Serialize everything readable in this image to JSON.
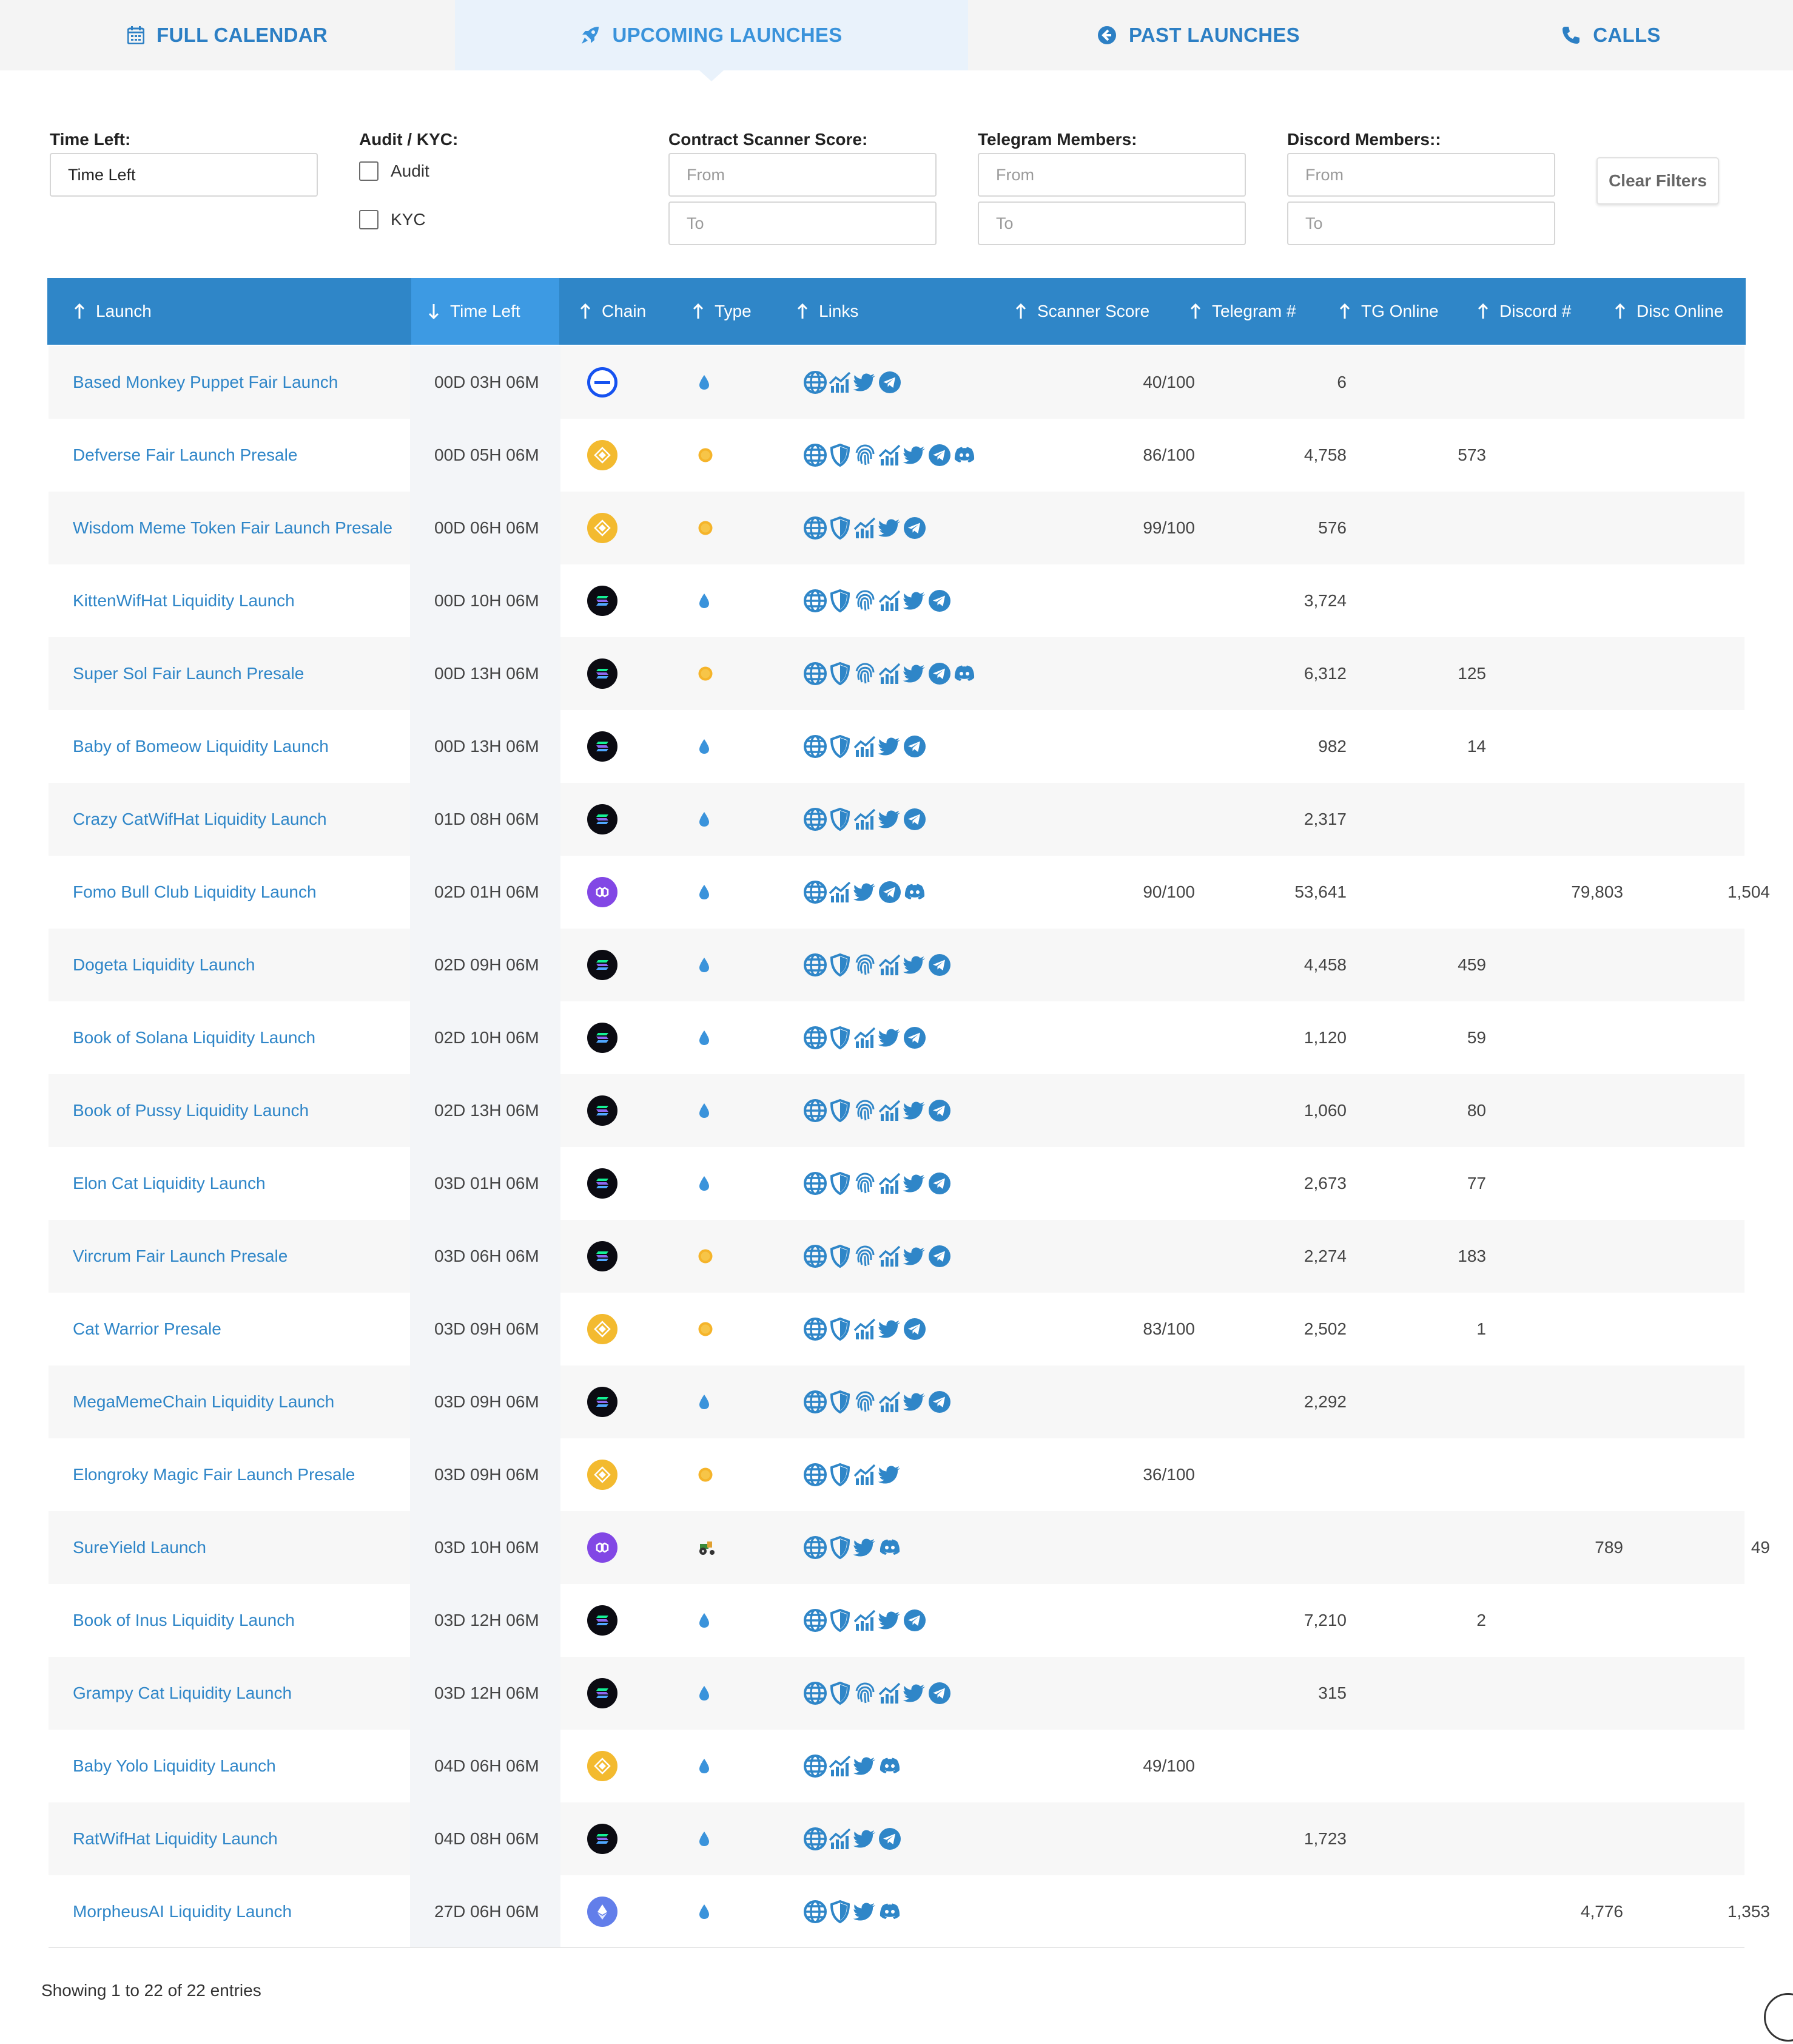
{
  "tabs": [
    {
      "label": "FULL CALENDAR",
      "icon": "calendar-icon"
    },
    {
      "label": "UPCOMING LAUNCHES",
      "icon": "rocket-icon",
      "active": true
    },
    {
      "label": "PAST LAUNCHES",
      "icon": "arrow-left-circle-icon"
    },
    {
      "label": "CALLS",
      "icon": "phone-icon"
    }
  ],
  "filters": {
    "time_left": {
      "label": "Time Left:",
      "value": "Time Left"
    },
    "audit_kyc": {
      "label": "Audit / KYC:",
      "options": [
        "Audit",
        "KYC"
      ]
    },
    "scanner": {
      "label": "Contract Scanner Score:",
      "from_placeholder": "From",
      "to_placeholder": "To"
    },
    "telegram": {
      "label": "Telegram Members:",
      "from_placeholder": "From",
      "to_placeholder": "To"
    },
    "discord": {
      "label": "Discord Members::",
      "from_placeholder": "From",
      "to_placeholder": "To"
    },
    "clear_label": "Clear Filters"
  },
  "table": {
    "columns": [
      "Launch",
      "Time Left",
      "Chain",
      "Type",
      "Links",
      "Scanner Score",
      "Telegram #",
      "TG Online",
      "Discord #",
      "Disc Online"
    ],
    "sorted_column": "Time Left",
    "rows": [
      {
        "launch": "Based Monkey Puppet Fair Launch",
        "time": "00D 03H 06M",
        "chain": "base",
        "type": "liquidity",
        "links": [
          "web",
          "chart",
          "twitter",
          "telegram"
        ],
        "score": "40/100",
        "tg": "6",
        "tg_online": "",
        "discord": "",
        "disc_online": ""
      },
      {
        "launch": "Defverse Fair Launch Presale",
        "time": "00D 05H 06M",
        "chain": "bnb",
        "type": "presale",
        "links": [
          "web",
          "shield",
          "fingerprint",
          "chart",
          "twitter",
          "telegram",
          "discord"
        ],
        "score": "86/100",
        "tg": "4,758",
        "tg_online": "573",
        "discord": "",
        "disc_online": ""
      },
      {
        "launch": "Wisdom Meme Token Fair Launch Presale",
        "time": "00D 06H 06M",
        "chain": "bnb",
        "type": "presale",
        "links": [
          "web",
          "shield",
          "chart",
          "twitter",
          "telegram"
        ],
        "score": "99/100",
        "tg": "576",
        "tg_online": "",
        "discord": "",
        "disc_online": ""
      },
      {
        "launch": "KittenWifHat Liquidity Launch",
        "time": "00D 10H 06M",
        "chain": "solana",
        "type": "liquidity",
        "links": [
          "web",
          "shield",
          "fingerprint",
          "chart",
          "twitter",
          "telegram"
        ],
        "score": "",
        "tg": "3,724",
        "tg_online": "",
        "discord": "",
        "disc_online": ""
      },
      {
        "launch": "Super Sol Fair Launch Presale",
        "time": "00D 13H 06M",
        "chain": "solana",
        "type": "presale",
        "links": [
          "web",
          "shield",
          "fingerprint",
          "chart",
          "twitter",
          "telegram",
          "discord"
        ],
        "score": "",
        "tg": "6,312",
        "tg_online": "125",
        "discord": "",
        "disc_online": ""
      },
      {
        "launch": "Baby of Bomeow Liquidity Launch",
        "time": "00D 13H 06M",
        "chain": "solana",
        "type": "liquidity",
        "links": [
          "web",
          "shield",
          "chart",
          "twitter",
          "telegram"
        ],
        "score": "",
        "tg": "982",
        "tg_online": "14",
        "discord": "",
        "disc_online": ""
      },
      {
        "launch": "Crazy CatWifHat Liquidity Launch",
        "time": "01D 08H 06M",
        "chain": "solana",
        "type": "liquidity",
        "links": [
          "web",
          "shield",
          "chart",
          "twitter",
          "telegram"
        ],
        "score": "",
        "tg": "2,317",
        "tg_online": "",
        "discord": "",
        "disc_online": ""
      },
      {
        "launch": "Fomo Bull Club Liquidity Launch",
        "time": "02D 01H 06M",
        "chain": "polygon",
        "type": "liquidity",
        "links": [
          "web",
          "chart",
          "twitter",
          "telegram",
          "discord"
        ],
        "score": "90/100",
        "tg": "53,641",
        "tg_online": "",
        "discord": "79,803",
        "disc_online": "1,504"
      },
      {
        "launch": "Dogeta Liquidity Launch",
        "time": "02D 09H 06M",
        "chain": "solana",
        "type": "liquidity",
        "links": [
          "web",
          "shield",
          "fingerprint",
          "chart",
          "twitter",
          "telegram"
        ],
        "score": "",
        "tg": "4,458",
        "tg_online": "459",
        "discord": "",
        "disc_online": ""
      },
      {
        "launch": "Book of Solana Liquidity Launch",
        "time": "02D 10H 06M",
        "chain": "solana",
        "type": "liquidity",
        "links": [
          "web",
          "shield",
          "chart",
          "twitter",
          "telegram"
        ],
        "score": "",
        "tg": "1,120",
        "tg_online": "59",
        "discord": "",
        "disc_online": ""
      },
      {
        "launch": "Book of Pussy Liquidity Launch",
        "time": "02D 13H 06M",
        "chain": "solana",
        "type": "liquidity",
        "links": [
          "web",
          "shield",
          "fingerprint",
          "chart",
          "twitter",
          "telegram"
        ],
        "score": "",
        "tg": "1,060",
        "tg_online": "80",
        "discord": "",
        "disc_online": ""
      },
      {
        "launch": "Elon Cat Liquidity Launch",
        "time": "03D 01H 06M",
        "chain": "solana",
        "type": "liquidity",
        "links": [
          "web",
          "shield",
          "fingerprint",
          "chart",
          "twitter",
          "telegram"
        ],
        "score": "",
        "tg": "2,673",
        "tg_online": "77",
        "discord": "",
        "disc_online": ""
      },
      {
        "launch": "Vircrum Fair Launch Presale",
        "time": "03D 06H 06M",
        "chain": "solana",
        "type": "presale",
        "links": [
          "web",
          "shield",
          "fingerprint",
          "chart",
          "twitter",
          "telegram"
        ],
        "score": "",
        "tg": "2,274",
        "tg_online": "183",
        "discord": "",
        "disc_online": ""
      },
      {
        "launch": "Cat Warrior Presale",
        "time": "03D 09H 06M",
        "chain": "bnb",
        "type": "presale",
        "links": [
          "web",
          "shield",
          "chart",
          "twitter",
          "telegram"
        ],
        "score": "83/100",
        "tg": "2,502",
        "tg_online": "1",
        "discord": "",
        "disc_online": ""
      },
      {
        "launch": "MegaMemeChain Liquidity Launch",
        "time": "03D 09H 06M",
        "chain": "solana",
        "type": "liquidity",
        "links": [
          "web",
          "shield",
          "fingerprint",
          "chart",
          "twitter",
          "telegram"
        ],
        "score": "",
        "tg": "2,292",
        "tg_online": "",
        "discord": "",
        "disc_online": ""
      },
      {
        "launch": "Elongroky Magic Fair Launch Presale",
        "time": "03D 09H 06M",
        "chain": "bnb",
        "type": "presale",
        "links": [
          "web",
          "shield",
          "chart",
          "twitter"
        ],
        "score": "36/100",
        "tg": "",
        "tg_online": "",
        "discord": "",
        "disc_online": ""
      },
      {
        "launch": "SureYield Launch",
        "time": "03D 10H 06M",
        "chain": "polygon",
        "type": "farm",
        "links": [
          "web",
          "shield",
          "twitter",
          "discord"
        ],
        "score": "",
        "tg": "",
        "tg_online": "",
        "discord": "789",
        "disc_online": "49"
      },
      {
        "launch": "Book of Inus Liquidity Launch",
        "time": "03D 12H 06M",
        "chain": "solana",
        "type": "liquidity",
        "links": [
          "web",
          "shield",
          "chart",
          "twitter",
          "telegram"
        ],
        "score": "",
        "tg": "7,210",
        "tg_online": "2",
        "discord": "",
        "disc_online": ""
      },
      {
        "launch": "Grampy Cat Liquidity Launch",
        "time": "03D 12H 06M",
        "chain": "solana",
        "type": "liquidity",
        "links": [
          "web",
          "shield",
          "fingerprint",
          "chart",
          "twitter",
          "telegram"
        ],
        "score": "",
        "tg": "315",
        "tg_online": "",
        "discord": "",
        "disc_online": ""
      },
      {
        "launch": "Baby Yolo Liquidity Launch",
        "time": "04D 06H 06M",
        "chain": "bnb",
        "type": "liquidity",
        "links": [
          "web",
          "chart",
          "twitter",
          "discord"
        ],
        "score": "49/100",
        "tg": "",
        "tg_online": "",
        "discord": "",
        "disc_online": ""
      },
      {
        "launch": "RatWifHat Liquidity Launch",
        "time": "04D 08H 06M",
        "chain": "solana",
        "type": "liquidity",
        "links": [
          "web",
          "chart",
          "twitter",
          "telegram"
        ],
        "score": "",
        "tg": "1,723",
        "tg_online": "",
        "discord": "",
        "disc_online": ""
      },
      {
        "launch": "MorpheusAI Liquidity Launch",
        "time": "27D 06H 06M",
        "chain": "ethereum",
        "type": "liquidity",
        "links": [
          "web",
          "shield",
          "twitter",
          "discord"
        ],
        "score": "",
        "tg": "",
        "tg_online": "",
        "discord": "4,776",
        "disc_online": "1,353"
      }
    ]
  },
  "footer": {
    "info": "Showing 1 to 22 of 22 entries"
  },
  "colors": {
    "accent": "#2f86c8",
    "header_bg": "#2f86c8",
    "tab_active_bg": "#e9f2fb",
    "link_text": "#2f86c8"
  }
}
